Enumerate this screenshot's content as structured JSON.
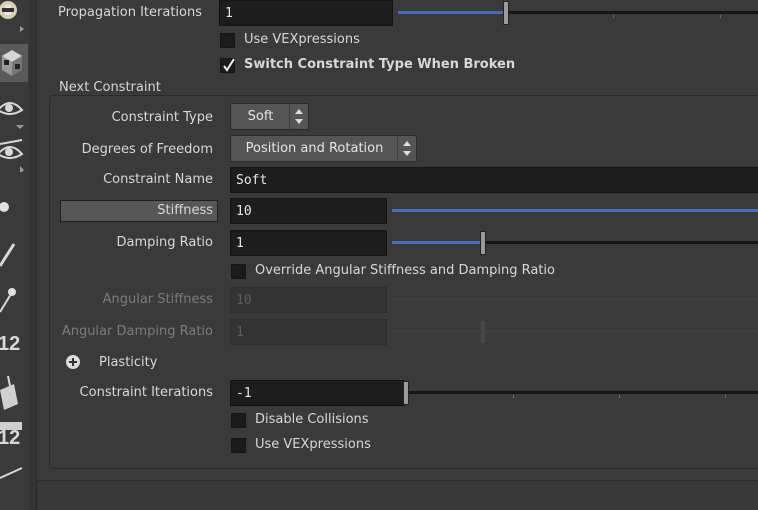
{
  "toolbar": {
    "icons": [
      "skull-icon",
      "cube-icon",
      "eye-icon",
      "eye-icon",
      "sphere-icon",
      "brush-icon",
      "pin-icon",
      "number-12-icon",
      "bucket-icon",
      "number-12-icon",
      "line-icon"
    ],
    "num_label_1": "12",
    "num_label_2": "12"
  },
  "params": {
    "propagation_iterations": {
      "label": "Propagation Iterations",
      "value": "1",
      "slider_fraction": 0.3
    },
    "use_vexpressions_top": {
      "label": "Use VEXpressions",
      "checked": false
    },
    "switch_constraint_type": {
      "label": "Switch Constraint Type When Broken",
      "checked": true
    }
  },
  "next_constraint": {
    "title": "Next Constraint",
    "constraint_type": {
      "label": "Constraint Type",
      "value": "Soft"
    },
    "degrees_of_freedom": {
      "label": "Degrees of Freedom",
      "value": "Position and Rotation"
    },
    "constraint_name": {
      "label": "Constraint Name",
      "value": "Soft"
    },
    "stiffness": {
      "label": "Stiffness",
      "value": "10",
      "slider_fraction": 1.0
    },
    "damping_ratio": {
      "label": "Damping Ratio",
      "value": "1",
      "slider_fraction": 0.25
    },
    "override_angular": {
      "label": "Override Angular Stiffness and Damping Ratio",
      "checked": false
    },
    "angular_stiffness": {
      "label": "Angular Stiffness",
      "value": "10",
      "enabled": false
    },
    "angular_damping_ratio": {
      "label": "Angular Damping Ratio",
      "value": "1",
      "enabled": false
    },
    "plasticity": {
      "label": "Plasticity",
      "expanded": false
    },
    "constraint_iterations": {
      "label": "Constraint Iterations",
      "value": "-1",
      "slider_fraction": 0.0
    },
    "disable_collisions": {
      "label": "Disable Collisions",
      "checked": false
    },
    "use_vexpressions": {
      "label": "Use VEXpressions",
      "checked": false
    }
  },
  "colors": {
    "background": "#3a3a3a",
    "field": "#1d1d1d",
    "slider_fill": "#3f6ebd",
    "highlight_label": "#575757"
  }
}
